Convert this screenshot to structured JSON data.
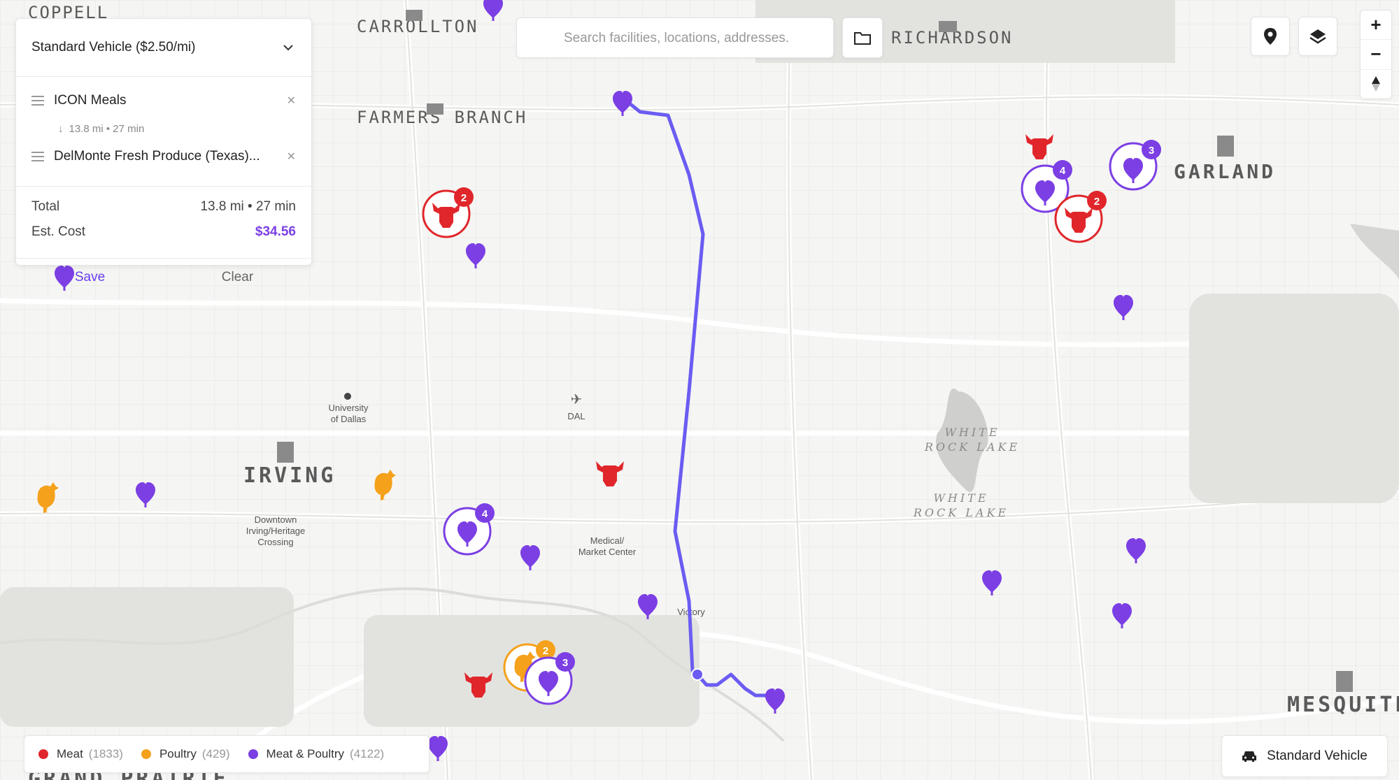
{
  "colors": {
    "meat": "#e0262b",
    "poultry": "#f5a11c",
    "meat_poultry": "#7b3fe4",
    "route": "#6b5cf2",
    "accent": "#6a3df0"
  },
  "map": {
    "cities": [
      "COPPELL",
      "CARROLLTON",
      "RICHARDSON",
      "FARMERS BRANCH",
      "GARLAND",
      "IRVING",
      "MESQUITE",
      "GRAND PRAIRIE"
    ],
    "landmarks": {
      "university": [
        "University",
        "of Dallas"
      ],
      "airport": "DAL",
      "downtown": [
        "Downtown",
        "Irving/Heritage",
        "Crossing"
      ],
      "medical": [
        "Medical/",
        "Market Center"
      ],
      "victory": "Victory",
      "lake_1": [
        "WHITE",
        "ROCK LAKE"
      ],
      "lake_2": [
        "WHITE",
        "ROCK LAKE"
      ]
    },
    "cluster_counts": {
      "meat_farmers_branch": "2",
      "meat_poultry_garland_a": "4",
      "meat_garland": "2",
      "meat_poultry_garland_b": "3",
      "meat_poultry_irving": "4",
      "poultry_south": "2",
      "meat_poultry_south": "3"
    }
  },
  "route_panel": {
    "vehicle": "Standard Vehicle ($2.50/mi)",
    "stops": [
      {
        "name": "ICON Meals"
      },
      {
        "name": "DelMonte Fresh Produce (Texas)..."
      }
    ],
    "leg": "13.8 mi • 27 min",
    "total_label": "Total",
    "total_value": "13.8 mi • 27 min",
    "cost_label": "Est. Cost",
    "cost_value": "$34.56",
    "save": "Save",
    "clear": "Clear"
  },
  "search": {
    "placeholder": "Search facilities, locations, addresses."
  },
  "zoom": {
    "in": "+",
    "out": "−"
  },
  "legend": [
    {
      "label": "Meat",
      "count": "(1833)"
    },
    {
      "label": "Poultry",
      "count": "(429)"
    },
    {
      "label": "Meat & Poultry",
      "count": "(4122)"
    }
  ],
  "vehicle_button": "Standard Vehicle"
}
